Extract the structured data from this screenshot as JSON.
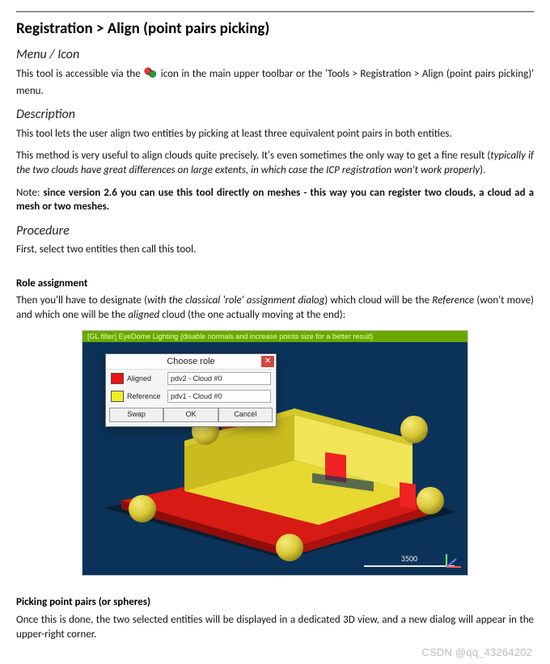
{
  "title": "Registration > Align (point pairs picking)",
  "sections": {
    "menu_icon": {
      "heading": "Menu / Icon",
      "p1a": "This tool is accessible via the ",
      "p1b": " icon in the main upper toolbar or the 'Tools > Registration > Align (point pairs picking)' menu."
    },
    "description": {
      "heading": "Description",
      "p1": "This tool lets the user align two entities by picking at least three equivalent point pairs in both entities.",
      "p2a": "This method is very useful to align clouds quite precisely. It's even sometimes the only way to get a fine result (",
      "p2i": "typically if the two clouds have great differences on large extents, in which case the ICP registration won't work properly",
      "p2b": ").",
      "p3a": "Note: ",
      "p3b": "since version 2.6 you can use this tool directly on meshes - this way you can register two clouds, a cloud ad a mesh or two meshes."
    },
    "procedure": {
      "heading": "Procedure",
      "p1": "First, select two entities then call this tool."
    },
    "role_assignment": {
      "heading": "Role assignment",
      "p1a": "Then you'll have to designate (",
      "p1i": "with the classical 'role' assignment dialog",
      "p1b": ") which cloud will be the ",
      "p1ref": "Reference",
      "p1c": " (won't move) and which one will be the ",
      "p1al": "aligned",
      "p1d": " cloud (the one actually moving at the end):"
    },
    "gl_banner": "[GL filter] EyeDome Lighting {disable normals and increase points size for a better result}",
    "dialog": {
      "title": "Choose role",
      "close": "✕",
      "aligned_label": "Aligned",
      "aligned_value": "pdv2 - Cloud #0",
      "reference_label": "Reference",
      "reference_value": "pdv1 - Cloud #0",
      "btn_swap": "Swap",
      "btn_ok": "OK",
      "btn_cancel": "Cancel"
    },
    "scalebar": "3500",
    "picking": {
      "heading": "Picking point pairs (or spheres)",
      "p1": "Once this is done, the two selected entities will be displayed in a dedicated 3D view, and a new dialog will appear in the upper-right corner."
    }
  },
  "watermark": "CSDN @qq_43264202"
}
